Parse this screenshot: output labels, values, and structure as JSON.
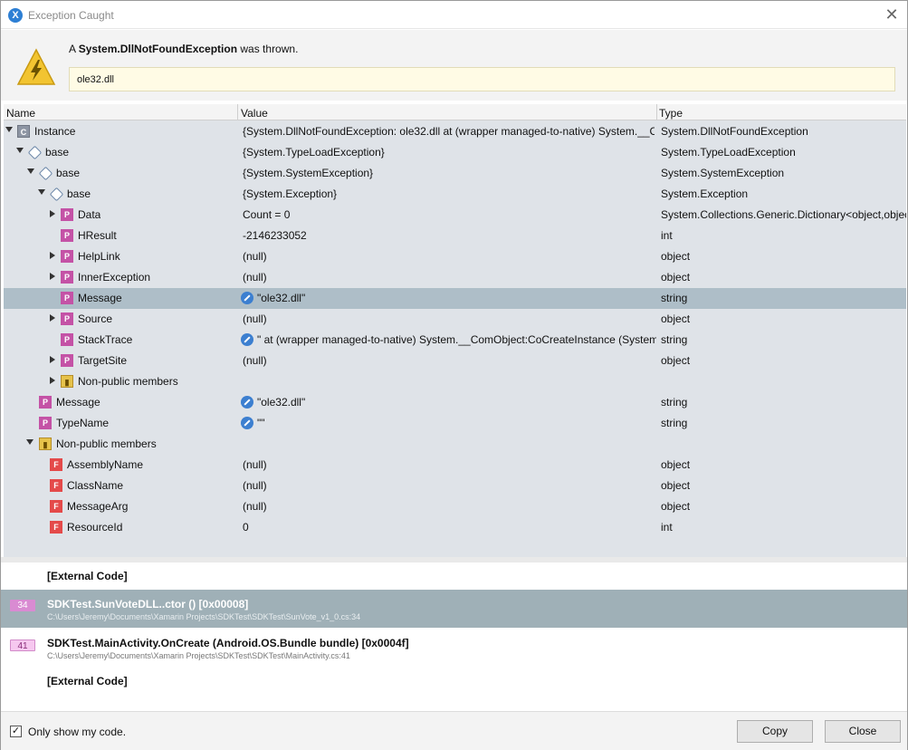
{
  "window": {
    "title": "Exception Caught",
    "close_label": "✕"
  },
  "exception": {
    "prefix": "A ",
    "type": "System.DllNotFoundException",
    "suffix": " was thrown.",
    "message": "ole32.dll"
  },
  "grid": {
    "columns": {
      "name": "Name",
      "value": "Value",
      "type": "Type"
    },
    "rows": [
      {
        "name": "Instance",
        "value": "{System.DllNotFoundException: ole32.dll   at (wrapper managed-to-native) System.__Co",
        "type": "System.DllNotFoundException"
      },
      {
        "name": "base",
        "value": "{System.TypeLoadException}",
        "type": "System.TypeLoadException"
      },
      {
        "name": "base",
        "value": "{System.SystemException}",
        "type": "System.SystemException"
      },
      {
        "name": "base",
        "value": "{System.Exception}",
        "type": "System.Exception"
      },
      {
        "name": "Data",
        "value": "Count = 0",
        "type": "System.Collections.Generic.Dictionary<object,objec"
      },
      {
        "name": "HResult",
        "value": "-2146233052",
        "type": "int"
      },
      {
        "name": "HelpLink",
        "value": "(null)",
        "type": "object"
      },
      {
        "name": "InnerException",
        "value": "(null)",
        "type": "object"
      },
      {
        "name": "Message",
        "value": "\"ole32.dll\"",
        "type": "string"
      },
      {
        "name": "Source",
        "value": "(null)",
        "type": "object"
      },
      {
        "name": "StackTrace",
        "value": "\"  at (wrapper managed-to-native) System.__ComObject:CoCreateInstance (System.",
        "type": "string"
      },
      {
        "name": "TargetSite",
        "value": "(null)",
        "type": "object"
      },
      {
        "name": "Non-public members",
        "value": "",
        "type": ""
      },
      {
        "name": "Message",
        "value": "\"ole32.dll\"",
        "type": "string"
      },
      {
        "name": "TypeName",
        "value": "\"\"",
        "type": "string"
      },
      {
        "name": "Non-public members",
        "value": "",
        "type": ""
      },
      {
        "name": "AssemblyName",
        "value": "(null)",
        "type": "object"
      },
      {
        "name": "ClassName",
        "value": "(null)",
        "type": "object"
      },
      {
        "name": "MessageArg",
        "value": "(null)",
        "type": "object"
      },
      {
        "name": "ResourceId",
        "value": "0",
        "type": "int"
      }
    ]
  },
  "stack": {
    "external1": "[External Code]",
    "frames": [
      {
        "line": "34",
        "title": "SDKTest.SunVoteDLL..ctor () [0x00008]",
        "path": "C:\\Users\\Jeremy\\Documents\\Xamarin Projects\\SDKTest\\SDKTest\\SunVote_v1_0.cs:34"
      },
      {
        "line": "41",
        "title": "SDKTest.MainActivity.OnCreate (Android.OS.Bundle bundle) [0x0004f]",
        "path": "C:\\Users\\Jeremy\\Documents\\Xamarin Projects\\SDKTest\\SDKTest\\MainActivity.cs:41"
      }
    ],
    "external2": "[External Code]"
  },
  "footer": {
    "checkbox_label": "Only show my code.",
    "checked": true,
    "copy": "Copy",
    "close": "Close"
  }
}
